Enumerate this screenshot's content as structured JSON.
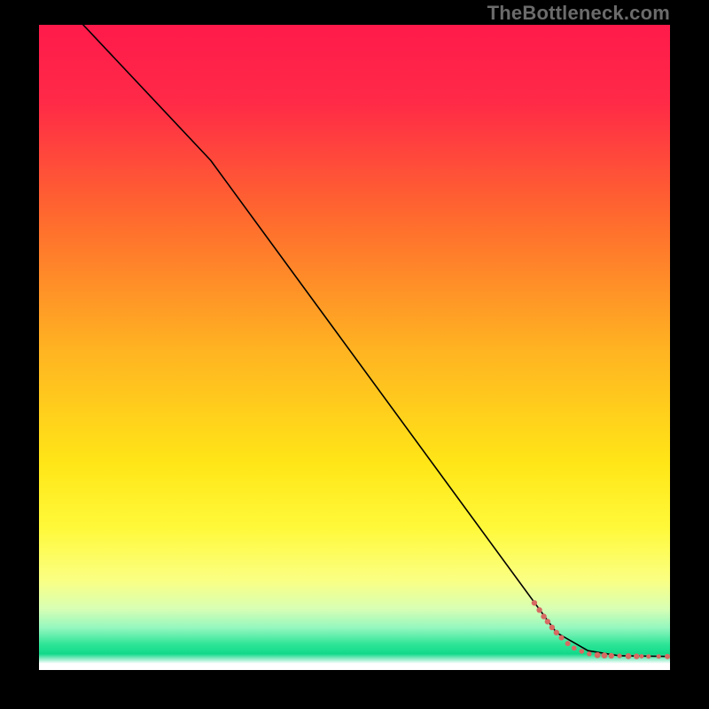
{
  "watermark": "TheBottleneck.com",
  "chart_data": {
    "type": "line",
    "title": "",
    "xlabel": "",
    "ylabel": "",
    "xlim": [
      0,
      100
    ],
    "ylim": [
      0,
      100
    ],
    "grid": false,
    "legend": false,
    "background_gradient": {
      "stops": [
        {
          "offset": 0.0,
          "color": "#ff1a4b"
        },
        {
          "offset": 0.12,
          "color": "#ff2a47"
        },
        {
          "offset": 0.3,
          "color": "#ff6a2e"
        },
        {
          "offset": 0.5,
          "color": "#ffb222"
        },
        {
          "offset": 0.68,
          "color": "#ffe617"
        },
        {
          "offset": 0.78,
          "color": "#fff93a"
        },
        {
          "offset": 0.86,
          "color": "#fbff82"
        },
        {
          "offset": 0.905,
          "color": "#d8ffb4"
        },
        {
          "offset": 0.935,
          "color": "#93f7bf"
        },
        {
          "offset": 0.96,
          "color": "#2fe597"
        },
        {
          "offset": 0.975,
          "color": "#11d98a"
        },
        {
          "offset": 0.99,
          "color": "#ffffff"
        },
        {
          "offset": 1.0,
          "color": "#ffffff"
        }
      ]
    },
    "series": [
      {
        "name": "curve",
        "color": "#000000",
        "stroke_width": 1.6,
        "x": [
          7.0,
          27.2,
          82.0,
          87.0,
          92.0,
          100.0
        ],
        "y": [
          100.0,
          79.0,
          5.8,
          3.0,
          2.2,
          2.1
        ]
      }
    ],
    "markers": {
      "name": "points",
      "color": "#d76a62",
      "items": [
        {
          "x": 78.5,
          "y": 10.4,
          "r": 3.2
        },
        {
          "x": 79.3,
          "y": 9.3,
          "r": 3.2
        },
        {
          "x": 80.0,
          "y": 8.3,
          "r": 3.2
        },
        {
          "x": 80.6,
          "y": 7.5,
          "r": 3.2
        },
        {
          "x": 81.3,
          "y": 6.6,
          "r": 3.2
        },
        {
          "x": 82.0,
          "y": 5.8,
          "r": 3.2
        },
        {
          "x": 82.8,
          "y": 5.0,
          "r": 3.0
        },
        {
          "x": 83.8,
          "y": 4.1,
          "r": 3.0
        },
        {
          "x": 84.8,
          "y": 3.4,
          "r": 2.8
        },
        {
          "x": 86.0,
          "y": 2.9,
          "r": 2.8
        },
        {
          "x": 87.2,
          "y": 2.5,
          "r": 2.7
        },
        {
          "x": 88.5,
          "y": 2.3,
          "r": 3.4
        },
        {
          "x": 89.6,
          "y": 2.25,
          "r": 3.4
        },
        {
          "x": 90.7,
          "y": 2.2,
          "r": 3.2
        },
        {
          "x": 92.0,
          "y": 2.2,
          "r": 2.6
        },
        {
          "x": 93.4,
          "y": 2.15,
          "r": 3.4
        },
        {
          "x": 94.7,
          "y": 2.12,
          "r": 3.2
        },
        {
          "x": 95.5,
          "y": 2.12,
          "r": 2.4
        },
        {
          "x": 96.6,
          "y": 2.1,
          "r": 2.6
        },
        {
          "x": 98.2,
          "y": 2.1,
          "r": 2.6
        },
        {
          "x": 99.6,
          "y": 2.1,
          "r": 3.0
        }
      ]
    }
  }
}
